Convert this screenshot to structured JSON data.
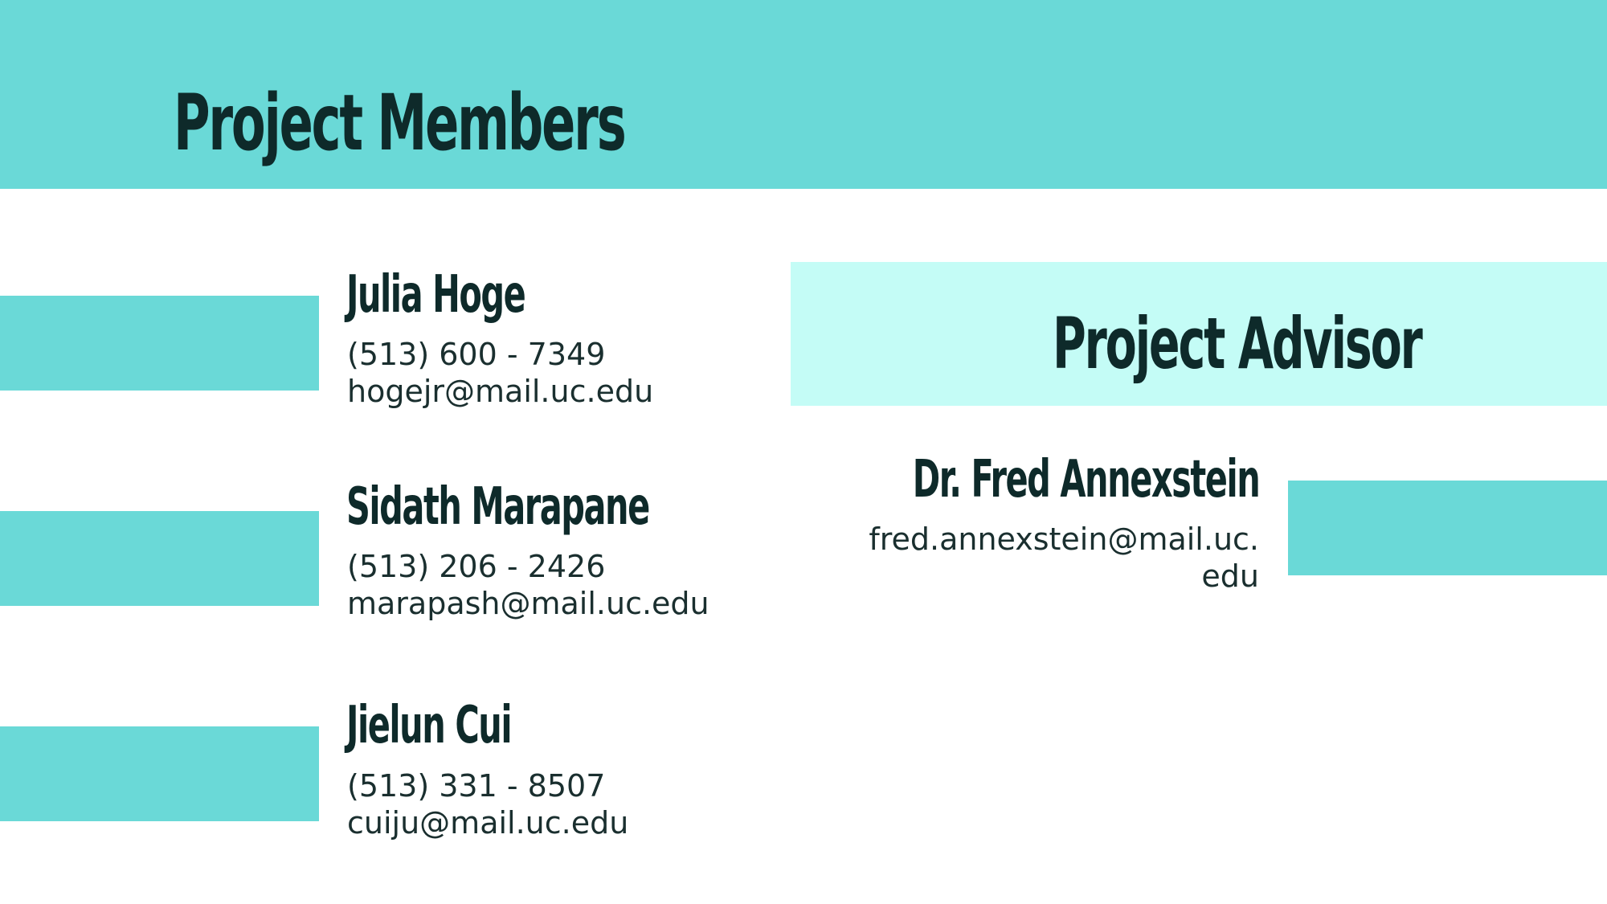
{
  "colors": {
    "accent": "#6ad9d7",
    "accent_light": "#c4fcf6",
    "text_dark": "#0e2a2a",
    "background": "#ffffff"
  },
  "members_section": {
    "title": "Project Members",
    "members": [
      {
        "name": "Julia Hoge",
        "phone": "(513) 600 - 7349",
        "email": "hogejr@mail.uc.edu"
      },
      {
        "name": "Sidath Marapane",
        "phone": "(513) 206 - 2426",
        "email": "marapash@mail.uc.edu"
      },
      {
        "name": "Jielun Cui",
        "phone": "(513) 331 - 8507",
        "email": "cuiju@mail.uc.edu"
      }
    ]
  },
  "advisor_section": {
    "title": "Project Advisor",
    "name": "Dr. Fred Annexstein",
    "email_line_1": "fred.annexstein@mail.uc.",
    "email_line_2": "edu"
  }
}
